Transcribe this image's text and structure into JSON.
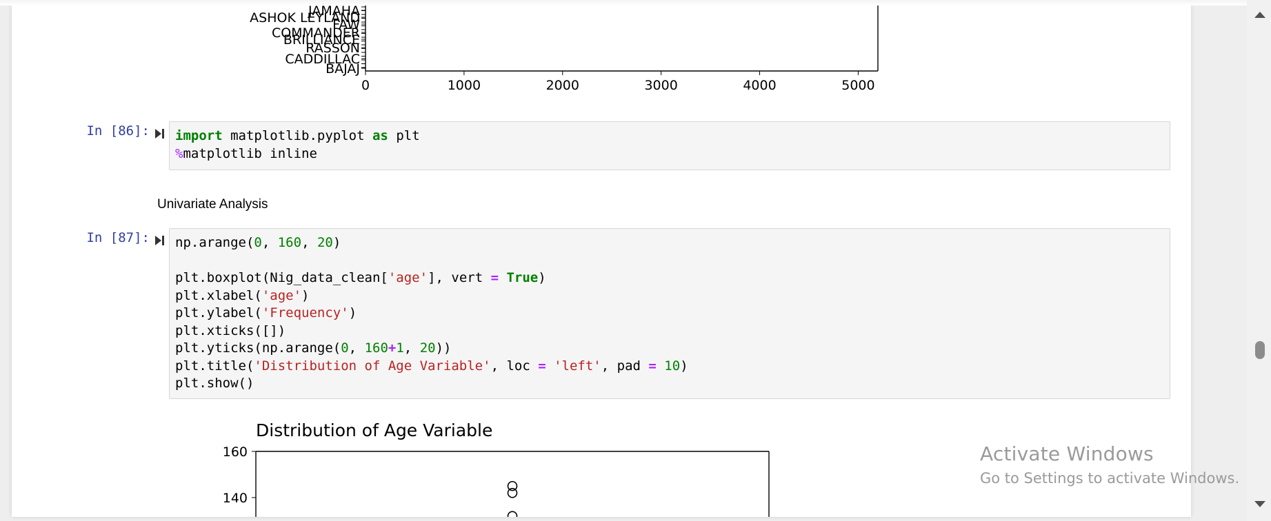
{
  "top_output": {
    "chart_data": {
      "type": "bar",
      "orientation": "horizontal",
      "visible_tick_labels_y": [
        "JAMAHA",
        "ASHOK LEYLAND",
        "FAW",
        "COMMANDER",
        "BRILLIANCE",
        "RASSON",
        "CADDILLAC",
        "BAJAJ"
      ],
      "x_ticks": [
        "0",
        "1000",
        "2000",
        "3000",
        "4000",
        "5000"
      ],
      "xlim": [
        0,
        5200
      ],
      "grid": false
    }
  },
  "cells": [
    {
      "prompt": "In [86]:",
      "lines": [
        [
          [
            "kw",
            "import"
          ],
          [
            "",
            " matplotlib.pyplot "
          ],
          [
            "kw",
            "as"
          ],
          [
            "",
            " plt"
          ]
        ],
        [
          [
            "mag",
            "%"
          ],
          [
            "",
            "matplotlib inline"
          ]
        ]
      ]
    },
    {
      "prompt": "In [87]:",
      "lines": [
        [
          [
            "",
            "np.arange("
          ],
          [
            "num",
            "0"
          ],
          [
            "",
            ", "
          ],
          [
            "num",
            "160"
          ],
          [
            "",
            ", "
          ],
          [
            "num",
            "20"
          ],
          [
            "",
            ")"
          ]
        ],
        [],
        [
          [
            "",
            "plt.boxplot(Nig_data_clean["
          ],
          [
            "str",
            "'age'"
          ],
          [
            "",
            "], vert "
          ],
          [
            "op",
            "="
          ],
          [
            "",
            " "
          ],
          [
            "bool",
            "True"
          ],
          [
            "",
            ")"
          ]
        ],
        [
          [
            "",
            "plt.xlabel("
          ],
          [
            "str",
            "'age'"
          ],
          [
            "",
            ")"
          ]
        ],
        [
          [
            "",
            "plt.ylabel("
          ],
          [
            "str",
            "'Frequency'"
          ],
          [
            "",
            ")"
          ]
        ],
        [
          [
            "",
            "plt.xticks([])"
          ]
        ],
        [
          [
            "",
            "plt.yticks(np.arange("
          ],
          [
            "num",
            "0"
          ],
          [
            "",
            ", "
          ],
          [
            "num",
            "160"
          ],
          [
            "op",
            "+"
          ],
          [
            "num",
            "1"
          ],
          [
            "",
            ", "
          ],
          [
            "num",
            "20"
          ],
          [
            "",
            "))"
          ]
        ],
        [
          [
            "",
            "plt.title("
          ],
          [
            "str",
            "'Distribution of Age Variable'"
          ],
          [
            "",
            ", loc "
          ],
          [
            "op",
            "="
          ],
          [
            "",
            " "
          ],
          [
            "str",
            "'left'"
          ],
          [
            "",
            ", pad "
          ],
          [
            "op",
            "="
          ],
          [
            "",
            " "
          ],
          [
            "num",
            "10"
          ],
          [
            "",
            ")"
          ]
        ],
        [
          [
            "",
            "plt.show()"
          ]
        ]
      ]
    }
  ],
  "markdown": {
    "text": "Univariate Analysis"
  },
  "boxplot_output": {
    "chart_data": {
      "type": "boxplot",
      "title": "Distribution of Age Variable",
      "y_ticks": [
        "160",
        "140"
      ],
      "ylim_visible": [
        130,
        160
      ],
      "outliers": [
        145,
        142,
        132
      ]
    }
  },
  "watermark": {
    "title": "Activate Windows",
    "subtitle": "Go to Settings to activate Windows."
  }
}
